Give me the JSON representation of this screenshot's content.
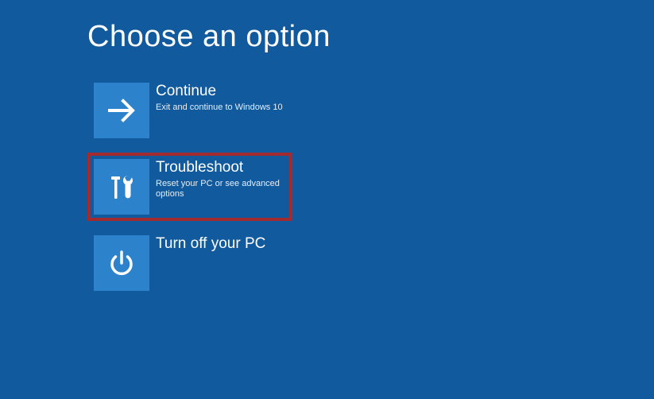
{
  "page": {
    "title": "Choose an option"
  },
  "options": {
    "continue": {
      "title": "Continue",
      "desc": "Exit and continue to Windows 10",
      "highlighted": false
    },
    "troubleshoot": {
      "title": "Troubleshoot",
      "desc": "Reset your PC or see advanced options",
      "highlighted": true
    },
    "turnoff": {
      "title": "Turn off your PC",
      "desc": "",
      "highlighted": false
    }
  },
  "colors": {
    "background": "#115a9e",
    "tile": "#2d83cb",
    "highlight": "#a32b2f"
  }
}
